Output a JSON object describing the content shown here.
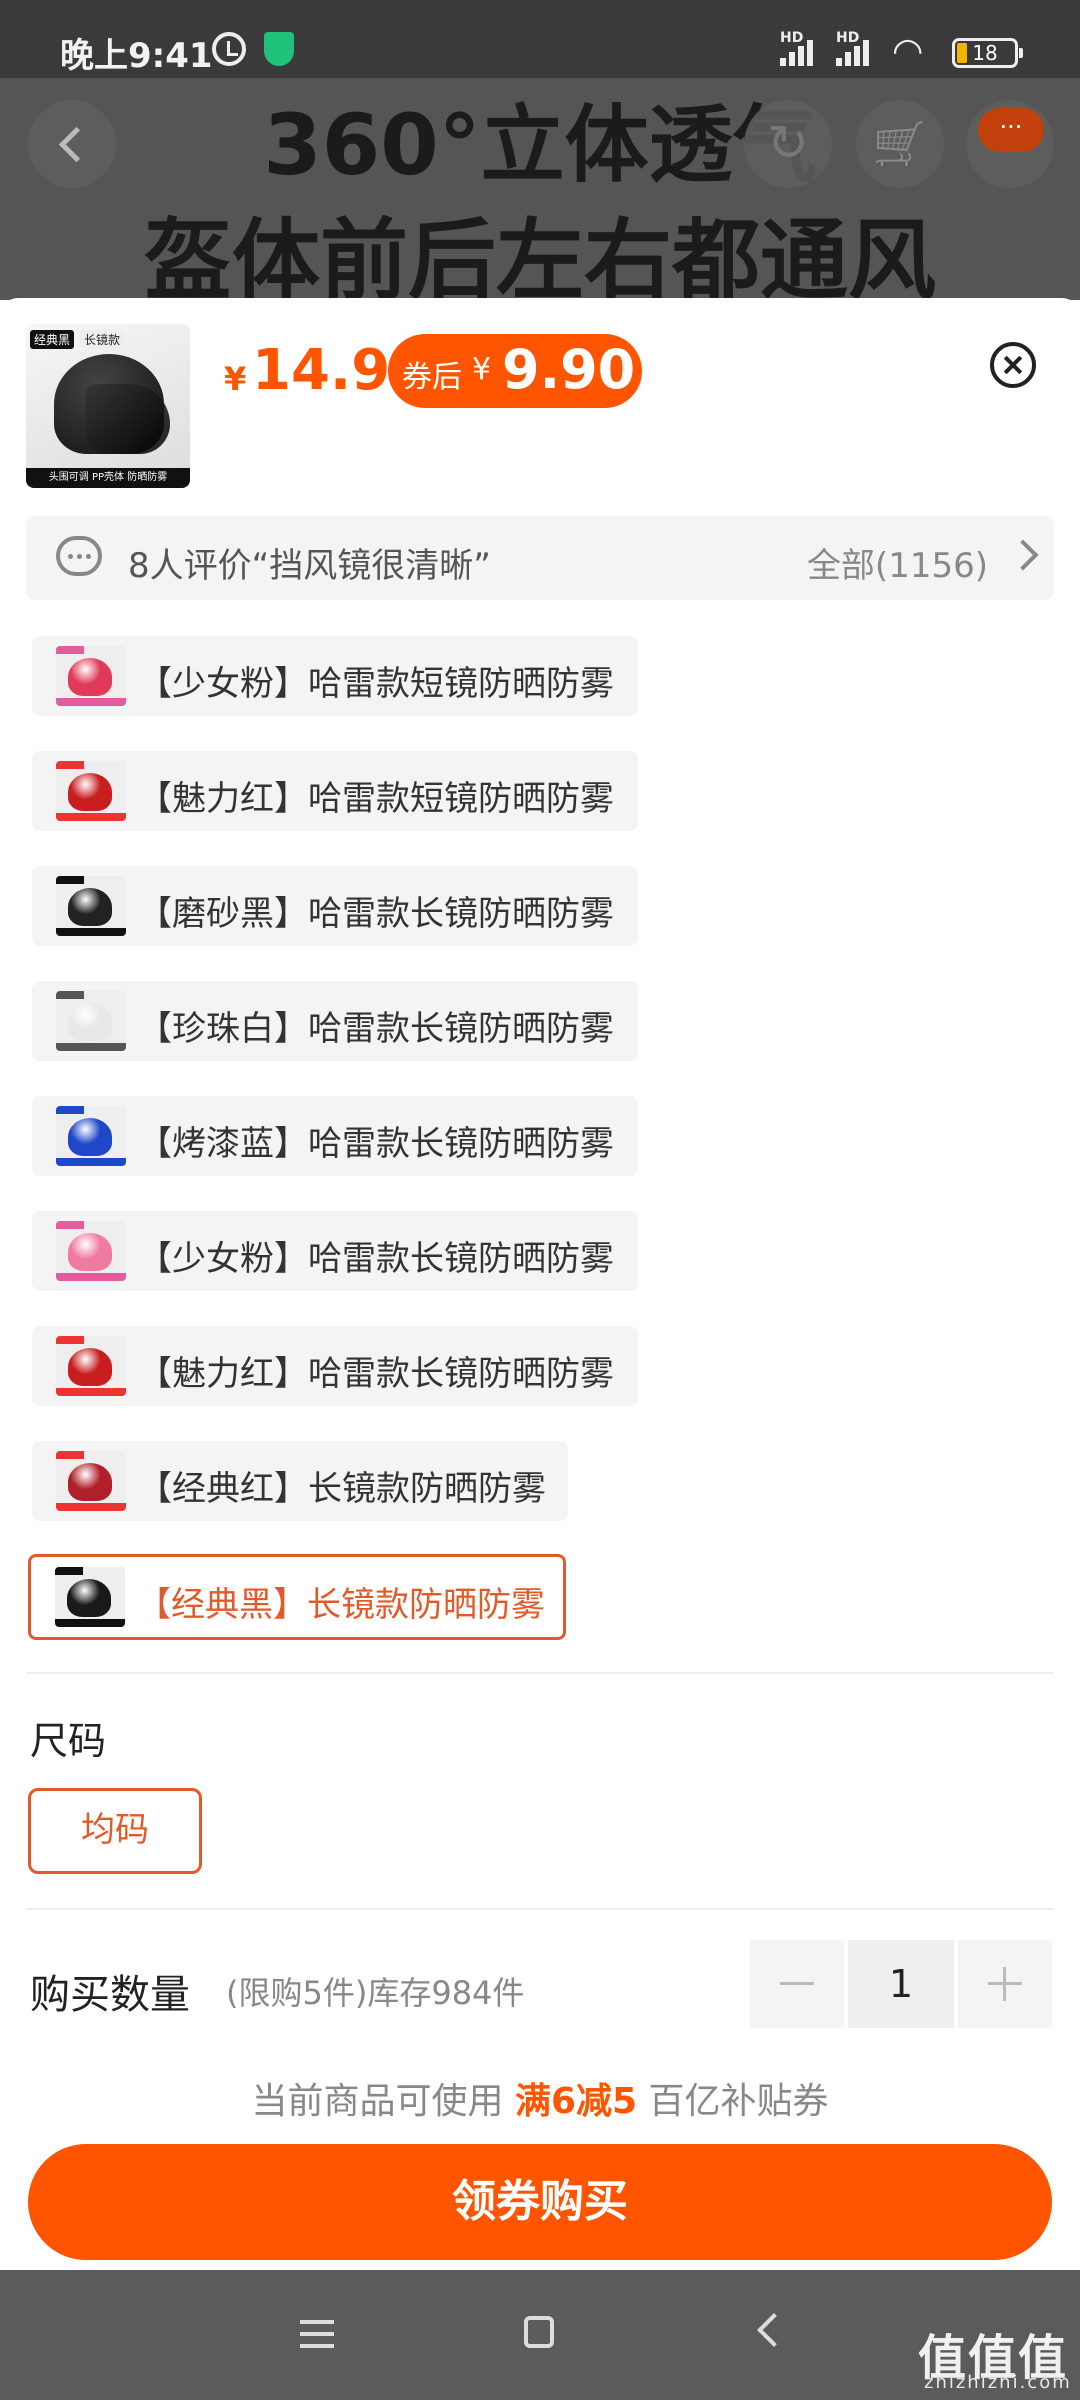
{
  "status_bar": {
    "time": "晚上9:41",
    "hd": "HD",
    "battery": "18"
  },
  "background": {
    "line1": "360°立体透气",
    "line2": "盔体前后左右都通风"
  },
  "header": {
    "more_badge": "···"
  },
  "product": {
    "thumb_tag": "经典黑",
    "thumb_tag2": "长镜款",
    "thumb_footer": "头围可调 PP壳体 防晒防雾",
    "price_symbol": "¥",
    "price": "14.9",
    "coupon_label": "券后",
    "coupon_symbol": "¥",
    "coupon_price": "9.90"
  },
  "review": {
    "text": "8人评价“挡风镜很清晰”",
    "all_label": "全部(1156)"
  },
  "options": [
    {
      "label": "【少女粉】哈雷款短镜防晒防雾",
      "selected": false,
      "color": "#e03a5a",
      "tag": "#e45c9c"
    },
    {
      "label": "【魅力红】哈雷款短镜防晒防雾",
      "selected": false,
      "color": "#c81e1e",
      "tag": "#e33"
    },
    {
      "label": "【磨砂黑】哈雷款长镜防晒防雾",
      "selected": false,
      "color": "#222222",
      "tag": "#111"
    },
    {
      "label": "【珍珠白】哈雷款长镜防晒防雾",
      "selected": false,
      "color": "#e8e8e8",
      "tag": "#555"
    },
    {
      "label": "【烤漆蓝】哈雷款长镜防晒防雾",
      "selected": false,
      "color": "#1f47c8",
      "tag": "#1f47c8"
    },
    {
      "label": "【少女粉】哈雷款长镜防晒防雾",
      "selected": false,
      "color": "#f07aa0",
      "tag": "#e45c9c"
    },
    {
      "label": "【魅力红】哈雷款长镜防晒防雾",
      "selected": false,
      "color": "#c81e1e",
      "tag": "#e33"
    },
    {
      "label": "【经典红】长镜款防晒防雾",
      "selected": false,
      "color": "#b0202a",
      "tag": "#e33"
    },
    {
      "label": "【经典黑】长镜款防晒防雾",
      "selected": true,
      "color": "#1a1a1a",
      "tag": "#111"
    }
  ],
  "size": {
    "title": "尺码",
    "option": "均码"
  },
  "quantity": {
    "title": "购买数量",
    "note": "(限购5件)库存984件",
    "value": "1"
  },
  "promo": {
    "prefix": "当前商品可使用 ",
    "highlight": "满6减5",
    "suffix": " 百亿补贴券"
  },
  "buy_button": "领券购买",
  "watermark": {
    "main": "值值值",
    "sub": "zhizhizhi.com"
  },
  "colors": {
    "accent": "#ff5500",
    "selected_border": "#e35a29"
  }
}
